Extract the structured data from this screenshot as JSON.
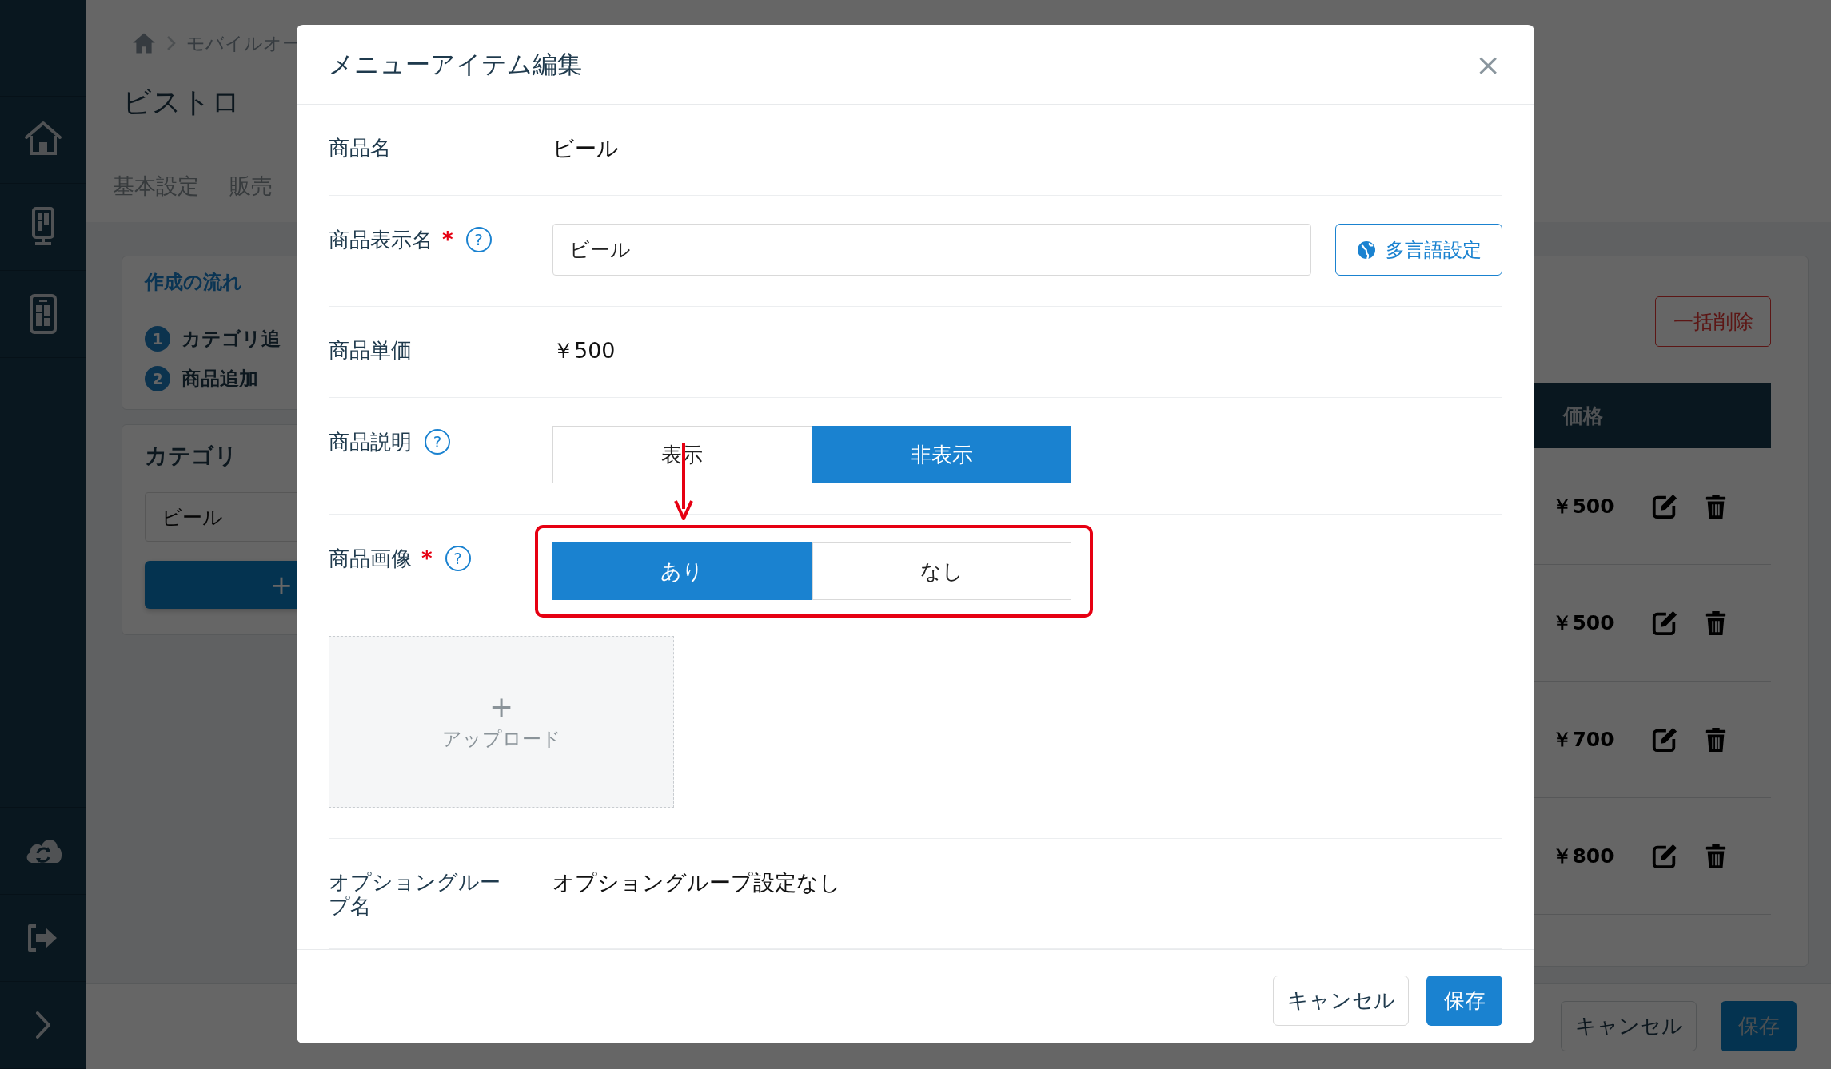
{
  "breadcrumb": {
    "items": [
      "モバイルオー"
    ]
  },
  "page_title": "ビストロ",
  "tabs": [
    "基本設定",
    "販売"
  ],
  "flow_card": {
    "title": "作成の流れ",
    "steps": [
      {
        "number": "1",
        "label": "カテゴリ追"
      },
      {
        "number": "2",
        "label": "商品追加"
      }
    ]
  },
  "category_card": {
    "title": "カテゴリ",
    "value": "ビール",
    "add_button": "+"
  },
  "item_list": {
    "bulk_delete": "一括削除",
    "columns": [
      "価格"
    ],
    "rows": [
      {
        "price": "￥500"
      },
      {
        "price": "￥500"
      },
      {
        "price": "￥700"
      },
      {
        "price": "￥800"
      }
    ]
  },
  "page_buttons": [
    {
      "label": "キャンセル",
      "kind": "secondary"
    },
    {
      "label": "保存",
      "kind": "primary"
    }
  ],
  "modal": {
    "title": "メニューアイテム編集",
    "close": "×",
    "fields": [
      {
        "kind": "text",
        "label": "商品名",
        "value": "ビール"
      },
      {
        "kind": "input",
        "label": "商品表示名",
        "required_mark": "*",
        "help": "?",
        "value": "ビール",
        "button": "多言語設定"
      },
      {
        "kind": "text",
        "label": "商品単価",
        "value": "￥500"
      },
      {
        "kind": "toggle",
        "label": "商品説明",
        "help": "?",
        "options": [
          {
            "label": "表示",
            "selected": false
          },
          {
            "label": "非表示",
            "selected": true
          }
        ]
      },
      {
        "kind": "toggle",
        "label": "商品画像",
        "required_mark": "*",
        "help": "?",
        "highlighted": true,
        "options": [
          {
            "label": "あり",
            "selected": true
          },
          {
            "label": "なし",
            "selected": false
          }
        ],
        "upload": {
          "plus": "+",
          "label": "アップロード"
        }
      },
      {
        "kind": "text",
        "label": "オプショングループ名",
        "value": "オプショングループ設定なし"
      }
    ],
    "annotations": [
      {
        "kind": "arrow"
      }
    ],
    "buttons": [
      {
        "label": "キャンセル",
        "kind": "secondary"
      },
      {
        "label": "保存",
        "kind": "primary"
      }
    ]
  }
}
